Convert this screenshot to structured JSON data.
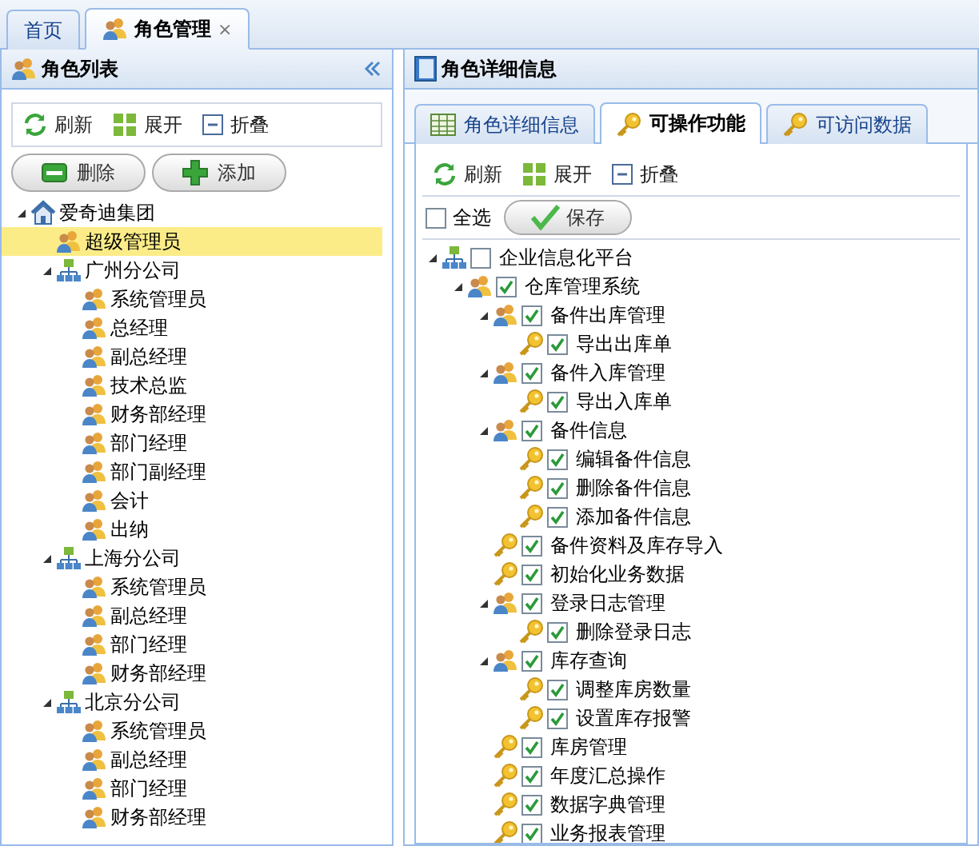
{
  "top_tabs": [
    {
      "kind": "plain",
      "label": "首页",
      "selected": false
    },
    {
      "kind": "role",
      "label": "角色管理",
      "selected": true,
      "close": "×"
    }
  ],
  "left_panel": {
    "title": "角色列表",
    "toolbar": [
      {
        "kind": "refresh",
        "label": "刷新"
      },
      {
        "kind": "expand",
        "label": "展开"
      },
      {
        "kind": "collapse",
        "label": "折叠"
      }
    ],
    "buttons": [
      {
        "kind": "remove",
        "label": "删除"
      },
      {
        "kind": "add",
        "label": "添加"
      }
    ],
    "tree": [
      {
        "kind": "home",
        "label": "爱奇迪集团",
        "selected": false,
        "expanded": true,
        "children": [
          {
            "kind": "role",
            "label": "超级管理员",
            "selected": true
          },
          {
            "kind": "org",
            "label": "广州分公司",
            "selected": false,
            "expanded": true,
            "children": [
              {
                "kind": "role",
                "label": "系统管理员",
                "selected": false
              },
              {
                "kind": "role",
                "label": "总经理",
                "selected": false
              },
              {
                "kind": "role",
                "label": "副总经理",
                "selected": false
              },
              {
                "kind": "role",
                "label": "技术总监",
                "selected": false
              },
              {
                "kind": "role",
                "label": "财务部经理",
                "selected": false
              },
              {
                "kind": "role",
                "label": "部门经理",
                "selected": false
              },
              {
                "kind": "role",
                "label": "部门副经理",
                "selected": false
              },
              {
                "kind": "role",
                "label": "会计",
                "selected": false
              },
              {
                "kind": "role",
                "label": "出纳",
                "selected": false
              }
            ]
          },
          {
            "kind": "org",
            "label": "上海分公司",
            "selected": false,
            "expanded": true,
            "children": [
              {
                "kind": "role",
                "label": "系统管理员",
                "selected": false
              },
              {
                "kind": "role",
                "label": "副总经理",
                "selected": false
              },
              {
                "kind": "role",
                "label": "部门经理",
                "selected": false
              },
              {
                "kind": "role",
                "label": "财务部经理",
                "selected": false
              }
            ]
          },
          {
            "kind": "org",
            "label": "北京分公司",
            "selected": false,
            "expanded": true,
            "children": [
              {
                "kind": "role",
                "label": "系统管理员",
                "selected": false
              },
              {
                "kind": "role",
                "label": "副总经理",
                "selected": false
              },
              {
                "kind": "role",
                "label": "部门经理",
                "selected": false
              },
              {
                "kind": "role",
                "label": "财务部经理",
                "selected": false
              }
            ]
          }
        ]
      }
    ]
  },
  "right_panel": {
    "title": "角色详细信息",
    "tabs": [
      {
        "kind": "table",
        "label": "角色详细信息",
        "selected": false
      },
      {
        "kind": "key",
        "label": "可操作功能",
        "selected": true
      },
      {
        "kind": "key",
        "label": "可访问数据",
        "selected": false
      }
    ],
    "toolbar": [
      {
        "kind": "refresh",
        "label": "刷新"
      },
      {
        "kind": "expand",
        "label": "展开"
      },
      {
        "kind": "collapse",
        "label": "折叠"
      }
    ],
    "select_all": {
      "label": "全选",
      "checked": false
    },
    "save_button": "保存",
    "tree": [
      {
        "kind": "org",
        "label": "企业信息化平台",
        "checked": false,
        "expanded": true,
        "children": [
          {
            "kind": "role",
            "label": "仓库管理系统",
            "checked": true,
            "expanded": true,
            "children": [
              {
                "kind": "role",
                "label": "备件出库管理",
                "checked": true,
                "expanded": true,
                "children": [
                  {
                    "kind": "key",
                    "label": "导出出库单",
                    "checked": true
                  }
                ]
              },
              {
                "kind": "role",
                "label": "备件入库管理",
                "checked": true,
                "expanded": true,
                "children": [
                  {
                    "kind": "key",
                    "label": "导出入库单",
                    "checked": true
                  }
                ]
              },
              {
                "kind": "role",
                "label": "备件信息",
                "checked": true,
                "expanded": true,
                "children": [
                  {
                    "kind": "key",
                    "label": "编辑备件信息",
                    "checked": true
                  },
                  {
                    "kind": "key",
                    "label": "删除备件信息",
                    "checked": true
                  },
                  {
                    "kind": "key",
                    "label": "添加备件信息",
                    "checked": true
                  }
                ]
              },
              {
                "kind": "key",
                "label": "备件资料及库存导入",
                "checked": true
              },
              {
                "kind": "key",
                "label": "初始化业务数据",
                "checked": true
              },
              {
                "kind": "role",
                "label": "登录日志管理",
                "checked": true,
                "expanded": true,
                "children": [
                  {
                    "kind": "key",
                    "label": "删除登录日志",
                    "checked": true
                  }
                ]
              },
              {
                "kind": "role",
                "label": "库存查询",
                "checked": true,
                "expanded": true,
                "children": [
                  {
                    "kind": "key",
                    "label": "调整库房数量",
                    "checked": true
                  },
                  {
                    "kind": "key",
                    "label": "设置库存报警",
                    "checked": true
                  }
                ]
              },
              {
                "kind": "key",
                "label": "库房管理",
                "checked": true
              },
              {
                "kind": "key",
                "label": "年度汇总操作",
                "checked": true
              },
              {
                "kind": "key",
                "label": "数据字典管理",
                "checked": true
              },
              {
                "kind": "key",
                "label": "业务报表管理",
                "checked": true
              }
            ]
          }
        ]
      }
    ]
  }
}
